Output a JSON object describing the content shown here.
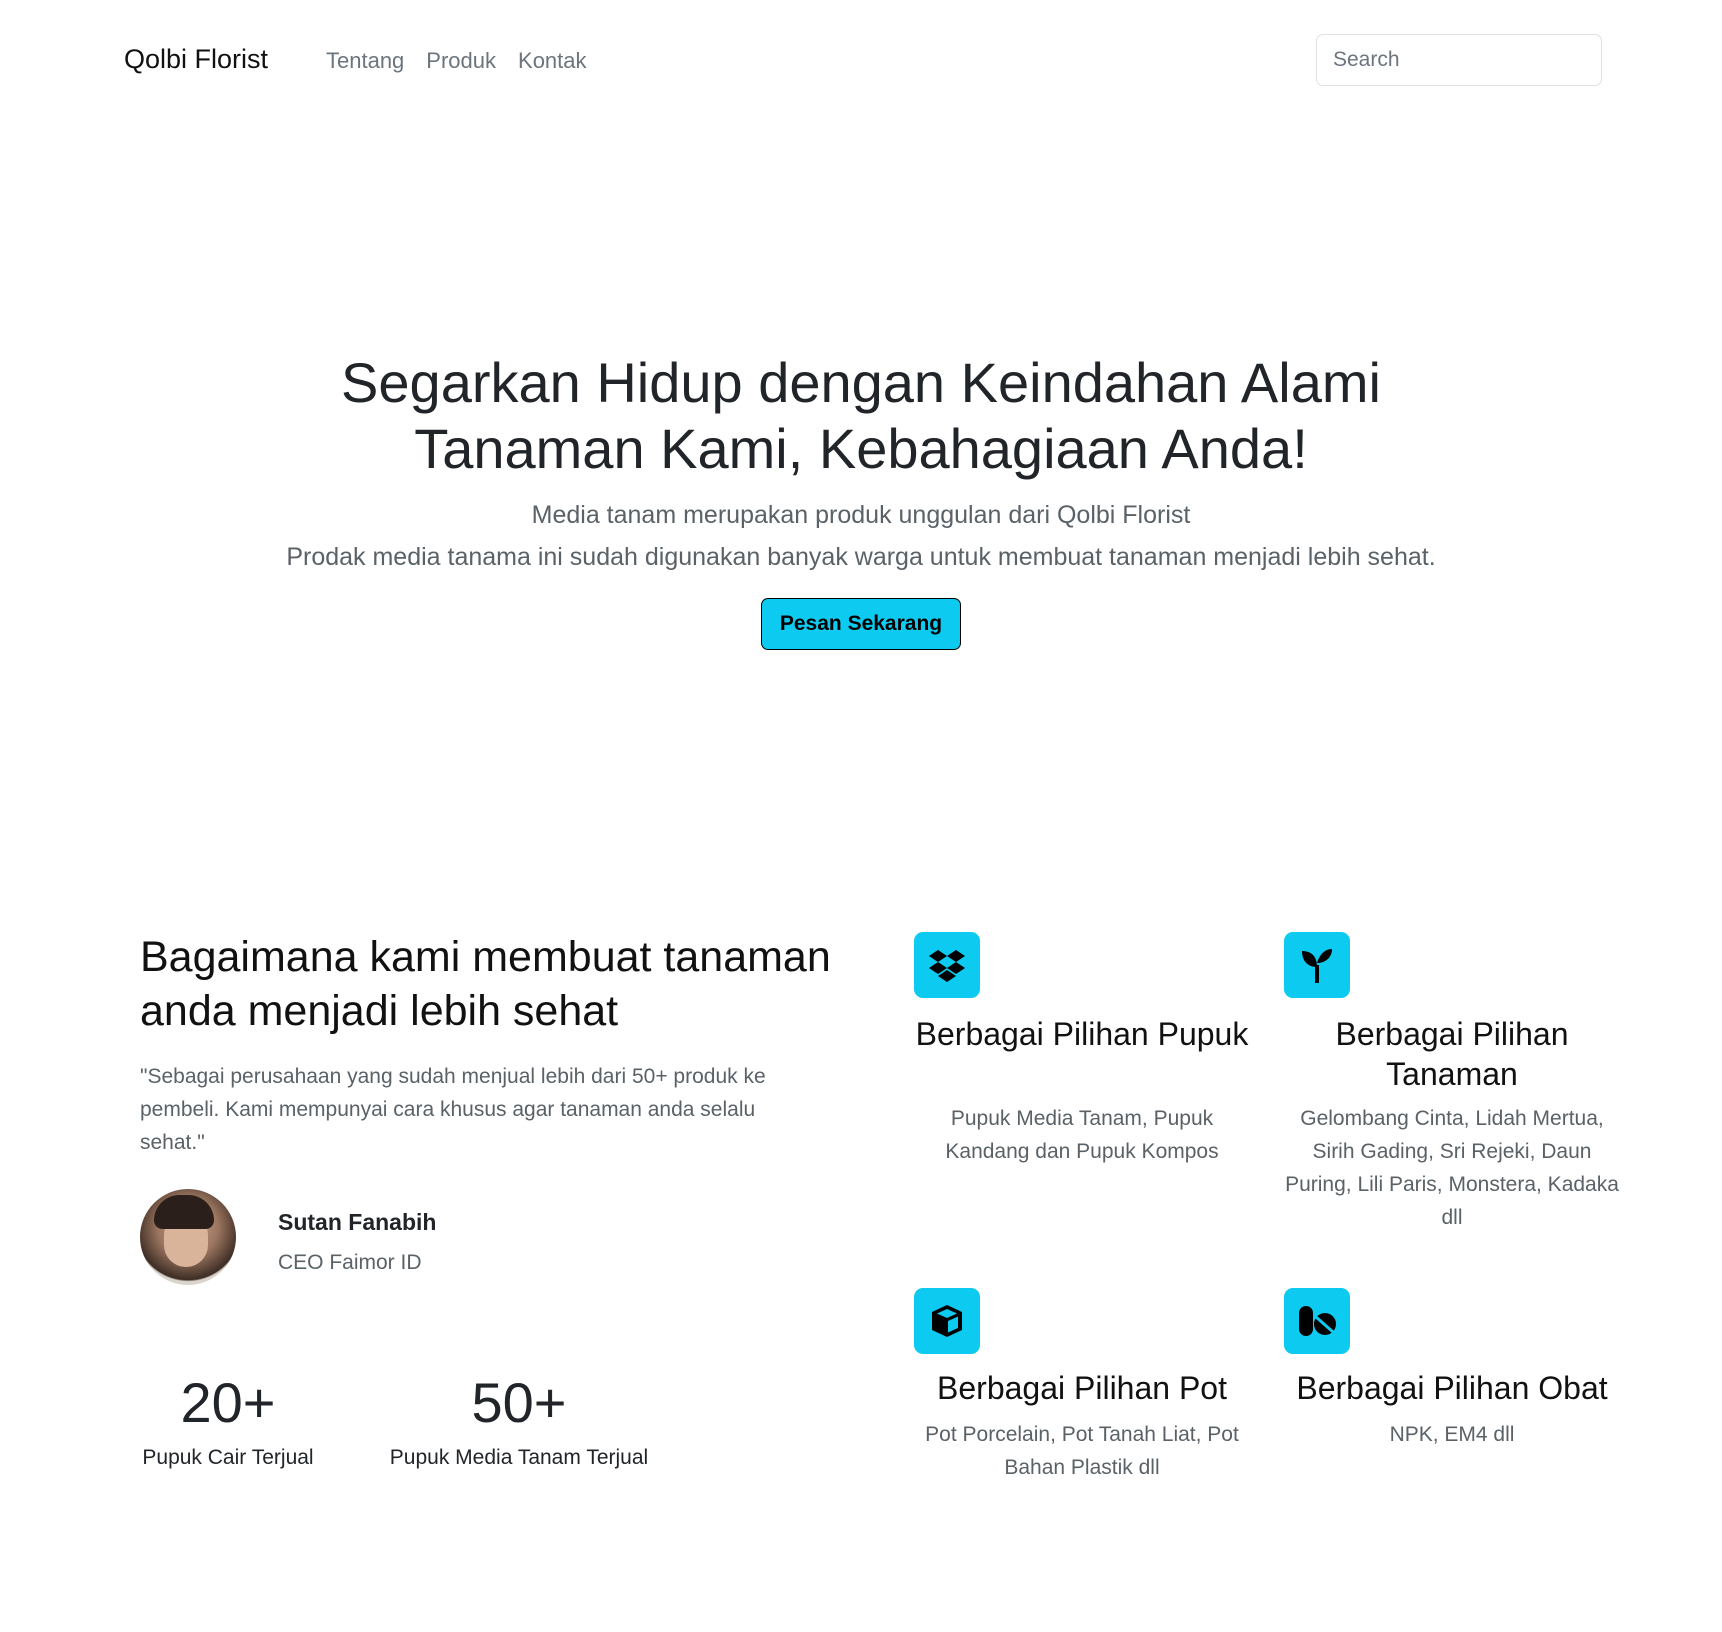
{
  "navbar": {
    "brand": "Qolbi Florist",
    "links": [
      "Tentang",
      "Produk",
      "Kontak"
    ],
    "search_placeholder": "Search"
  },
  "hero": {
    "title": "Segarkan Hidup dengan Keindahan Alami Tanaman Kami, Kebahagiaan Anda!",
    "lead_line1": "Media tanam merupakan produk unggulan dari Qolbi Florist",
    "lead_line2": "Prodak media tanama ini sudah digunakan banyak warga untuk membuat tanaman menjadi lebih sehat.",
    "cta_label": "Pesan Sekarang"
  },
  "about": {
    "heading": "Bagaimana kami membuat tanaman anda menjadi lebih sehat",
    "quote": "\"Sebagai perusahaan yang sudah menjual lebih dari 50+ produk ke pembeli. Kami mempunyai cara khusus agar tanaman anda selalu sehat.\"",
    "person": {
      "name": "Sutan Fanabih",
      "role": "CEO Faimor ID"
    },
    "stats": [
      {
        "value": "20+",
        "label": "Pupuk Cair Terjual"
      },
      {
        "value": "50+",
        "label": "Pupuk Media Tanam Terjual"
      }
    ]
  },
  "features": [
    {
      "icon": "dropbox-icon",
      "title": "Berbagai Pilihan Pupuk",
      "desc": "Pupuk Media Tanam, Pupuk Kandang dan Pupuk Kompos"
    },
    {
      "icon": "sprout-icon",
      "title": "Berbagai Pilihan Tanaman",
      "desc": "Gelombang Cinta, Lidah Mertua, Sirih Gading, Sri Rejeki, Daun Puring, Lili Paris, Monstera, Kadaka dll"
    },
    {
      "icon": "box-icon",
      "title": "Berbagai Pilihan Pot",
      "desc": "Pot Porcelain, Pot Tanah Liat, Pot Bahan Plastik dll"
    },
    {
      "icon": "capsule-pill-icon",
      "title": "Berbagai Pilihan Obat",
      "desc": "NPK, EM4 dll"
    }
  ],
  "colors": {
    "accent": "#0dcaf0",
    "text": "#212529",
    "muted": "#6c757d"
  }
}
